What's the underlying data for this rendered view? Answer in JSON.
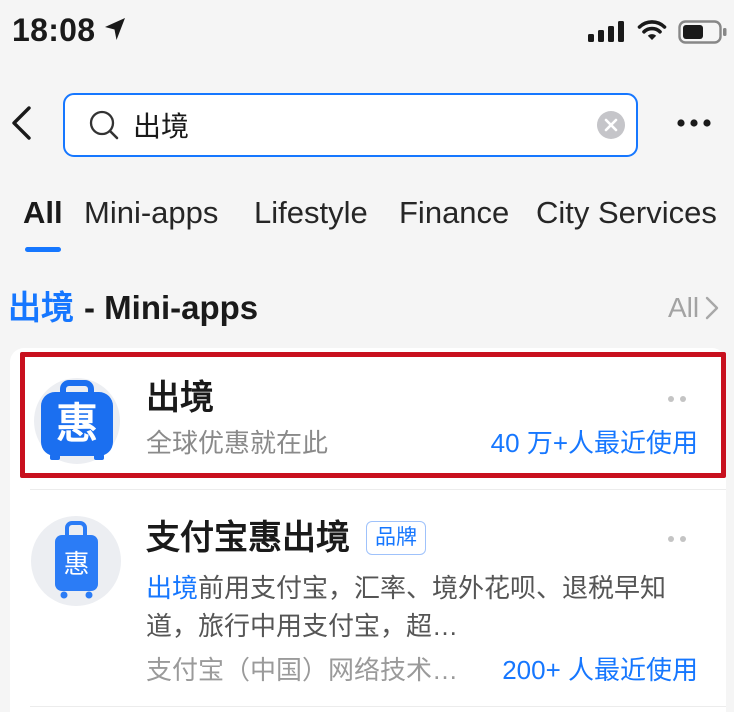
{
  "status_bar": {
    "time": "18:08",
    "icons": [
      "location-arrow-icon",
      "cellular-signal-icon",
      "wifi-icon",
      "battery-icon"
    ]
  },
  "header": {
    "back_icon": "chevron-left-icon",
    "search": {
      "value": "出境",
      "search_icon": "search-icon",
      "clear_icon": "clear-icon"
    },
    "more_icon": "more-dots-icon"
  },
  "tabs": [
    {
      "label": "All",
      "active": true
    },
    {
      "label": "Mini-apps",
      "active": false
    },
    {
      "label": "Lifestyle",
      "active": false
    },
    {
      "label": "Finance",
      "active": false
    },
    {
      "label": "City Services",
      "active": false
    }
  ],
  "section": {
    "keyword": "出境",
    "suffix": "- Mini-apps",
    "more_label": "All",
    "more_icon": "chevron-right-icon"
  },
  "results": [
    {
      "icon": "luggage-icon",
      "icon_glyph": "惠",
      "title": "出境",
      "subtitle": "全球优惠就在此",
      "usage": "40 万+人最近使用",
      "options_icon": "more-options-icon",
      "highlighted": true
    },
    {
      "icon": "luggage-icon",
      "icon_glyph": "惠",
      "title": "支付宝惠出境",
      "badge": "品牌",
      "description_highlight": "出境",
      "description": "前用支付宝，汇率、境外花呗、退税早知道，旅行中用支付宝，超…",
      "provider": "支付宝（中国）网络技术…",
      "usage": "200+ 人最近使用",
      "options_icon": "more-options-icon",
      "highlighted": false
    }
  ],
  "colors": {
    "accent": "#1677ff",
    "highlight_border": "#c8101e",
    "background": "#f5f5f5",
    "card": "#ffffff"
  }
}
